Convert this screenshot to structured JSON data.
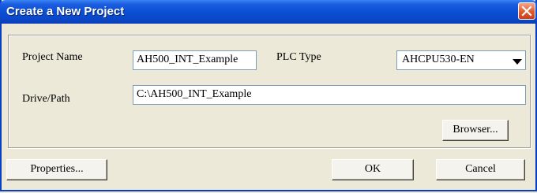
{
  "dialog": {
    "title": "Create a New Project"
  },
  "form": {
    "project_name_label": "Project Name",
    "project_name_value": "AH500_INT_Example",
    "plc_type_label": "PLC Type",
    "plc_type_value": "AHCPU530-EN",
    "drive_path_label": "Drive/Path",
    "drive_path_value": "C:\\AH500_INT_Example"
  },
  "buttons": {
    "browser": "Browser...",
    "properties": "Properties...",
    "ok": "OK",
    "cancel": "Cancel"
  },
  "icons": {
    "close": "close-icon",
    "dropdown": "chevron-down-icon"
  },
  "colors": {
    "titlebar": "#0a4fd6",
    "close_button": "#e2582c",
    "dialog_background": "#ece9d8"
  }
}
